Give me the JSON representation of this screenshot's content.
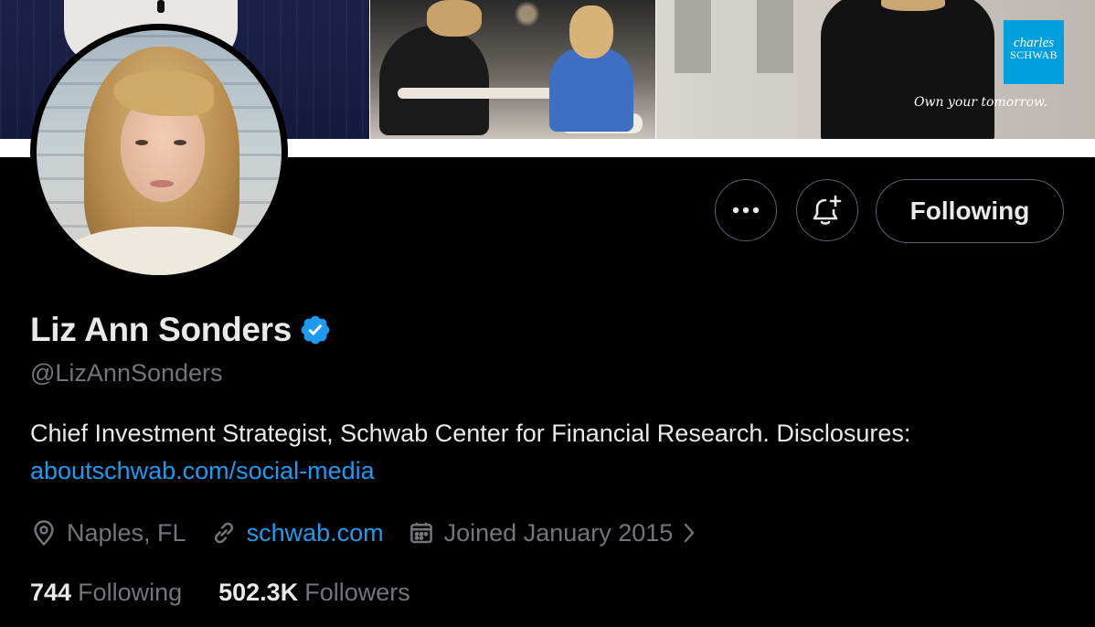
{
  "banner": {
    "logo_line1": "charles",
    "logo_line2": "SCHWAB",
    "tagline": "Own your tomorrow.",
    "brand_color": "#00a0df"
  },
  "actions": {
    "more_icon": "more-horizontal-icon",
    "notify_icon": "bell-plus-icon",
    "following_label": "Following"
  },
  "profile": {
    "name": "Liz Ann Sonders",
    "verified_icon": "verified-badge-icon",
    "handle": "@LizAnnSonders",
    "bio_text": "Chief Investment Strategist, Schwab Center for Financial Research. Disclosures:",
    "bio_link": "aboutschwab.com/social-media",
    "location": "Naples, FL",
    "website": "schwab.com",
    "joined": "Joined January 2015"
  },
  "stats": {
    "following_count": "744",
    "following_label": "Following",
    "followers_count": "502.3K",
    "followers_label": "Followers"
  },
  "colors": {
    "background": "#000000",
    "text_primary": "#e7e9ea",
    "text_secondary": "#71767b",
    "link": "#1d9bf0",
    "border": "#536471"
  }
}
